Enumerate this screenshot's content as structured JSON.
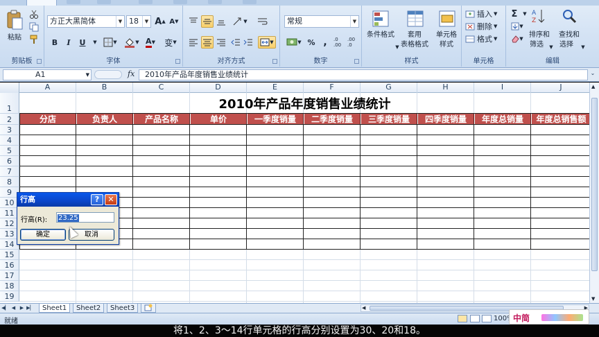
{
  "ribbon": {
    "clipboard": {
      "group_label": "剪贴板",
      "paste_label": "粘贴"
    },
    "font": {
      "group_label": "字体",
      "font_name": "方正大黑简体",
      "font_size": "18",
      "bold": "B",
      "italic": "I",
      "underline": "U",
      "grow_glyph": "A",
      "shrink_glyph": "A",
      "font_color_glyph": "A",
      "phonetic_glyph": "变"
    },
    "alignment": {
      "group_label": "对齐方式"
    },
    "number": {
      "group_label": "数字",
      "format": "常规",
      "percent": "%",
      "comma": ",",
      "increase_decimal": ".0 .00",
      "decrease_decimal": ".00 .0"
    },
    "styles": {
      "group_label": "样式",
      "conditional": "条件格式",
      "format_as_table_line1": "套用",
      "format_as_table_line2": "表格格式",
      "cell_styles_line1": "单元格",
      "cell_styles_line2": "样式"
    },
    "cells": {
      "group_label": "单元格",
      "insert": "插入",
      "delete": "删除",
      "format": "格式"
    },
    "editing": {
      "group_label": "编辑",
      "sigma": "Σ",
      "sort_line1": "排序和",
      "sort_line2": "筛选",
      "find_line1": "查找和",
      "find_line2": "选择"
    }
  },
  "formula_bar": {
    "name_box": "A1",
    "fx": "fx",
    "content": "2010年产品年度销售业绩统计"
  },
  "columns": [
    "A",
    "B",
    "C",
    "D",
    "E",
    "F",
    "G",
    "H",
    "I",
    "J"
  ],
  "rows": [
    "1",
    "2",
    "3",
    "4",
    "5",
    "6",
    "7",
    "8",
    "9",
    "10",
    "11",
    "12",
    "13",
    "14",
    "15",
    "16",
    "17",
    "18",
    "19"
  ],
  "sheet": {
    "title": "2010年产品年度销售业绩统计",
    "headers": [
      "分店",
      "负责人",
      "产品名称",
      "单价",
      "一季度销量",
      "二季度销量",
      "三季度销量",
      "四季度销量",
      "年度总销量",
      "年度总销售额"
    ]
  },
  "sheet_tabs": [
    "Sheet1",
    "Sheet2",
    "Sheet3"
  ],
  "status": {
    "text": "就绪",
    "zoom": "100%"
  },
  "ime": {
    "text": "中简"
  },
  "dialog": {
    "title": "行高",
    "help": "?",
    "close": "✕",
    "field_label": "行高(R):",
    "field_value": "23.25",
    "ok": "确定",
    "cancel": "取消"
  },
  "caption": "将1、2、3～14行单元格的行高分别设置为30、20和18。",
  "colors": {
    "header_fill": "#c0504d",
    "ribbon": "#d6e4f5",
    "dialog_title": "#0b46c9"
  }
}
